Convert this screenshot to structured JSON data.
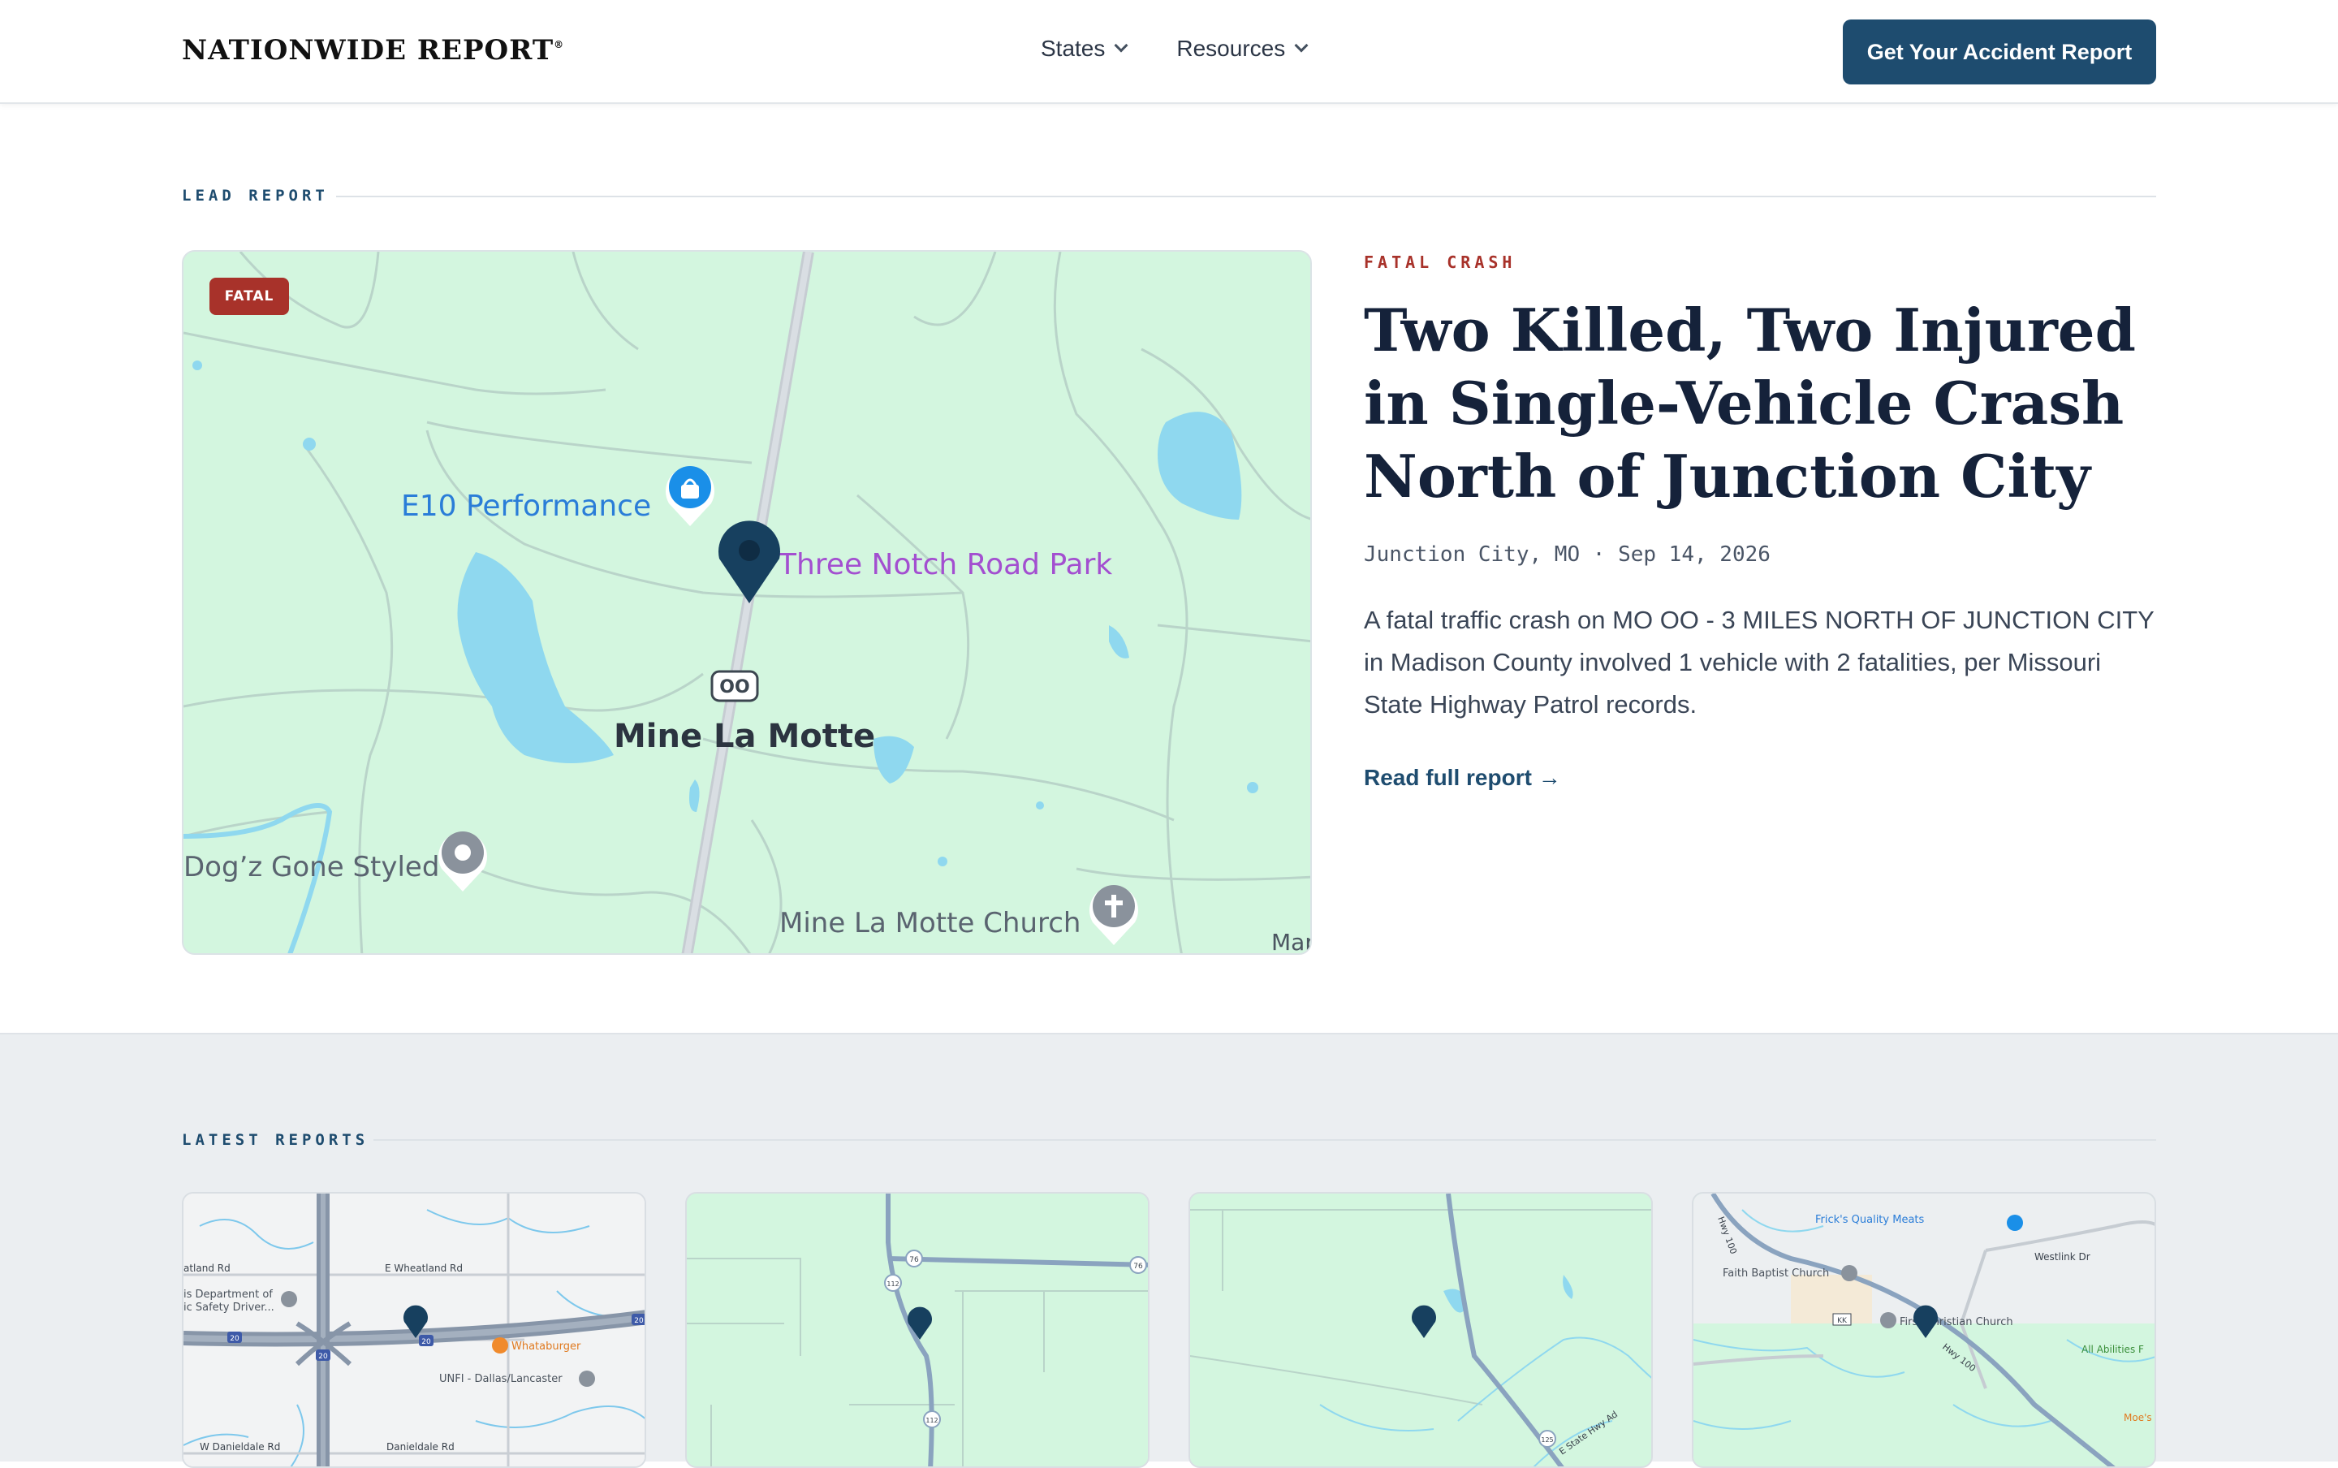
{
  "header": {
    "logo_text": "NATIONWIDE REPORT",
    "logo_mark": "®",
    "nav": [
      {
        "label": "States"
      },
      {
        "label": "Resources"
      }
    ],
    "cta_label": "Get Your Accident Report"
  },
  "lead": {
    "section_label": "LEAD REPORT",
    "badge": "FATAL",
    "kicker": "FATAL CRASH",
    "headline": "Two Killed, Two Injured in Single-Vehicle Crash North of Junction City",
    "meta": "Junction City, MO · Sep 14, 2026",
    "summary": "A fatal traffic crash on MO OO - 3 MILES NORTH OF JUNCTION CITY in Madison County involved 1 vehicle with 2 fatalities, per Missouri State Highway Patrol records.",
    "read_more": "Read full report →",
    "map": {
      "labels": {
        "poi_performance": "E10 Performance",
        "poi_park": "Three Notch Road Park",
        "town": "Mine La Motte",
        "route_shield": "OO",
        "poi_dog": "Dog’z Gone Styled",
        "poi_church": "Mine La Motte Church",
        "attribution": "Map"
      }
    }
  },
  "latest": {
    "section_label": "LATEST REPORTS",
    "cards": [
      {
        "map_labels": {
          "road1": "atland Rd",
          "road2": "E Wheatland Rd",
          "poi1": "is Department of",
          "poi1b": "ic Safety Driver...",
          "poi2": "Whataburger",
          "poi3": "UNFI - Dallas/Lancaster",
          "road3": "W Danieldale Rd",
          "road4": "Danieldale Rd",
          "shield1": "20",
          "shield2": "20",
          "shield3": "20",
          "shield4": "20"
        }
      },
      {
        "map_labels": {
          "shield1": "76",
          "shield2": "76",
          "shield3": "112",
          "shield4": "112"
        }
      },
      {
        "map_labels": {
          "shield1": "125",
          "road1": "E State Hwy Ad"
        }
      },
      {
        "map_labels": {
          "poi1": "Frick's Quality Meats",
          "poi2": "Faith Baptist Church",
          "poi3": "First Christian Church",
          "road1": "Westlink Dr",
          "road2": "Hwy 100",
          "road3": "Hwy 100",
          "poi4": "All Abilities F",
          "poi5": "Moe's",
          "shield1": "KK"
        }
      }
    ]
  },
  "colors": {
    "brand": "#1e4c6f",
    "fatal": "#a8322a",
    "map_land": "#d3f6df",
    "map_water": "#8fd8ef",
    "pin": "#17405f"
  }
}
